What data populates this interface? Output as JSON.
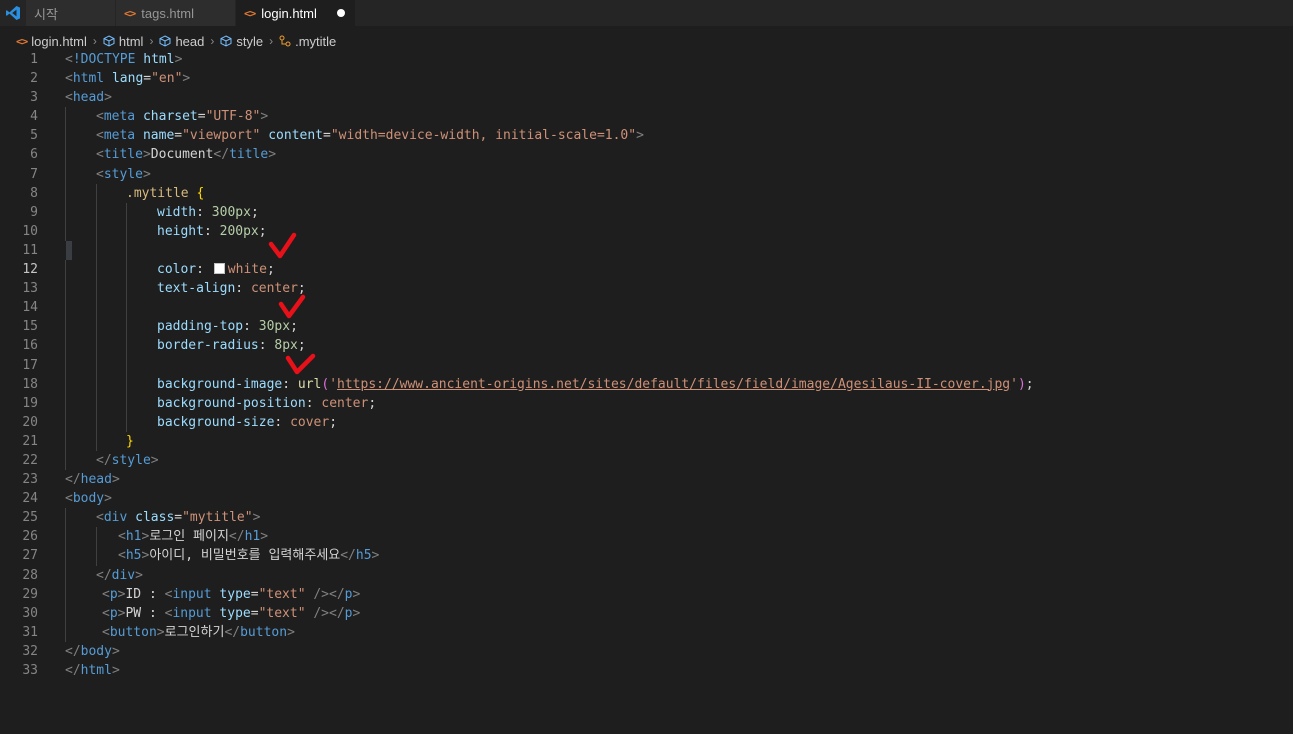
{
  "tabs": [
    {
      "label": "시작",
      "icon": "vscode-icon"
    },
    {
      "label": "tags.html",
      "icon": "html-file-icon"
    },
    {
      "label": "login.html",
      "icon": "html-file-icon",
      "active": true,
      "dirty": true
    }
  ],
  "breadcrumb": [
    "login.html",
    "html",
    "head",
    "style",
    ".mytitle"
  ],
  "editor": {
    "current_line": 12,
    "line_numbers": [
      "1",
      "2",
      "3",
      "4",
      "5",
      "6",
      "7",
      "8",
      "9",
      "10",
      "11",
      "12",
      "13",
      "14",
      "15",
      "16",
      "17",
      "18",
      "19",
      "20",
      "21",
      "22",
      "23",
      "24",
      "25",
      "26",
      "27",
      "28",
      "29",
      "30",
      "31",
      "32",
      "33"
    ],
    "code": {
      "l1_doctype": "!DOCTYPE",
      "l1_html": "html",
      "l2_html": "html",
      "l2_lang": "lang",
      "l2_lang_val": "\"en\"",
      "l3_head": "head",
      "l4_meta": "meta",
      "l4_charset": "charset",
      "l4_charset_val": "\"UTF-8\"",
      "l5_meta": "meta",
      "l5_name": "name",
      "l5_name_val": "\"viewport\"",
      "l5_content": "content",
      "l5_content_val": "\"width=device-width, initial-scale=1.0\"",
      "l6_title_open": "title",
      "l6_text": "Document",
      "l6_title_close": "title",
      "l7_style": "style",
      "l8_selector": ".mytitle",
      "l9_prop": "width",
      "l9_val": "300px",
      "l10_prop": "height",
      "l10_val": "200px",
      "l12_prop": "color",
      "l12_val": "white",
      "l13_prop": "text-align",
      "l13_val": "center",
      "l15_prop": "padding-top",
      "l15_val": "30px",
      "l16_prop": "border-radius",
      "l16_val": "8px",
      "l18_prop": "background-image",
      "l18_fn": "url",
      "l18_url": "https://www.ancient-origins.net/sites/default/files/field/image/Agesilaus-II-cover.jpg",
      "l19_prop": "background-position",
      "l19_val": "center",
      "l20_prop": "background-size",
      "l20_val": "cover",
      "l22_style": "style",
      "l23_head": "head",
      "l24_body": "body",
      "l25_div": "div",
      "l25_class": "class",
      "l25_class_val": "\"mytitle\"",
      "l26_h1": "h1",
      "l26_text": "로그인 페이지",
      "l26_h1_close": "h1",
      "l27_h5": "h5",
      "l27_text": "아이디, 비밀번호를 입력해주세요",
      "l27_h5_close": "h5",
      "l28_div": "div",
      "l29_p": "p",
      "l29_text": "ID : ",
      "l29_input": "input",
      "l29_type": "type",
      "l29_type_val": "\"text\"",
      "l29_p_close": "p",
      "l30_p": "p",
      "l30_text": "PW : ",
      "l30_input": "input",
      "l30_type": "type",
      "l30_type_val": "\"text\"",
      "l30_p_close": "p",
      "l31_button": "button",
      "l31_text": "로그인하기",
      "l31_button_close": "button",
      "l32_body": "body",
      "l33_html": "html"
    }
  },
  "colors": {
    "background": "#1e1e1e",
    "tag": "#569cd6",
    "attribute": "#9cdcfe",
    "string": "#ce9178",
    "number": "#b5cea8",
    "selector": "#d7ba7d",
    "annotation": "#e8111a"
  }
}
